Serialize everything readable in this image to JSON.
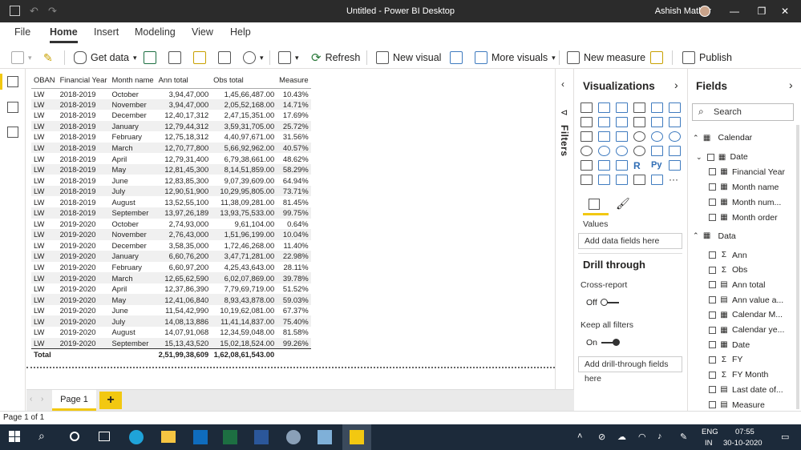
{
  "window": {
    "title": "Untitled - Power BI Desktop",
    "user": "Ashish Mathur"
  },
  "menu": [
    "File",
    "Home",
    "Insert",
    "Modeling",
    "View",
    "Help"
  ],
  "menu_active": "Home",
  "ribbon": {
    "get_data": "Get data",
    "refresh": "Refresh",
    "new_visual": "New visual",
    "more_visuals": "More visuals",
    "new_measure": "New measure",
    "publish": "Publish"
  },
  "table": {
    "headers": [
      "OBAN",
      "Financial Year",
      "Month name",
      "Ann total",
      "Obs total",
      "Measure"
    ],
    "rows": [
      [
        "LW",
        "2018-2019",
        "October",
        "3,94,47,000",
        "1,45,66,487.00",
        "10.43%"
      ],
      [
        "LW",
        "2018-2019",
        "November",
        "3,94,47,000",
        "2,05,52,168.00",
        "14.71%"
      ],
      [
        "LW",
        "2018-2019",
        "December",
        "12,40,17,312",
        "2,47,15,351.00",
        "17.69%"
      ],
      [
        "LW",
        "2018-2019",
        "January",
        "12,79,44,312",
        "3,59,31,705.00",
        "25.72%"
      ],
      [
        "LW",
        "2018-2019",
        "February",
        "12,75,18,312",
        "4,40,97,671.00",
        "31.56%"
      ],
      [
        "LW",
        "2018-2019",
        "March",
        "12,70,77,800",
        "5,66,92,962.00",
        "40.57%"
      ],
      [
        "LW",
        "2018-2019",
        "April",
        "12,79,31,400",
        "6,79,38,661.00",
        "48.62%"
      ],
      [
        "LW",
        "2018-2019",
        "May",
        "12,81,45,300",
        "8,14,51,859.00",
        "58.29%"
      ],
      [
        "LW",
        "2018-2019",
        "June",
        "12,83,85,300",
        "9,07,39,609.00",
        "64.94%"
      ],
      [
        "LW",
        "2018-2019",
        "July",
        "12,90,51,900",
        "10,29,95,805.00",
        "73.71%"
      ],
      [
        "LW",
        "2018-2019",
        "August",
        "13,52,55,100",
        "11,38,09,281.00",
        "81.45%"
      ],
      [
        "LW",
        "2018-2019",
        "September",
        "13,97,26,189",
        "13,93,75,533.00",
        "99.75%"
      ],
      [
        "LW",
        "2019-2020",
        "October",
        "2,74,93,000",
        "9,61,104.00",
        "0.64%"
      ],
      [
        "LW",
        "2019-2020",
        "November",
        "2,76,43,000",
        "1,51,96,199.00",
        "10.04%"
      ],
      [
        "LW",
        "2019-2020",
        "December",
        "3,58,35,000",
        "1,72,46,268.00",
        "11.40%"
      ],
      [
        "LW",
        "2019-2020",
        "January",
        "6,60,76,200",
        "3,47,71,281.00",
        "22.98%"
      ],
      [
        "LW",
        "2019-2020",
        "February",
        "6,60,97,200",
        "4,25,43,643.00",
        "28.11%"
      ],
      [
        "LW",
        "2019-2020",
        "March",
        "12,65,62,590",
        "6,02,07,869.00",
        "39.78%"
      ],
      [
        "LW",
        "2019-2020",
        "April",
        "12,37,86,390",
        "7,79,69,719.00",
        "51.52%"
      ],
      [
        "LW",
        "2019-2020",
        "May",
        "12,41,06,840",
        "8,93,43,878.00",
        "59.03%"
      ],
      [
        "LW",
        "2019-2020",
        "June",
        "11,54,42,990",
        "10,19,62,081.00",
        "67.37%"
      ],
      [
        "LW",
        "2019-2020",
        "July",
        "14,08,13,886",
        "11,41,14,837.00",
        "75.40%"
      ],
      [
        "LW",
        "2019-2020",
        "August",
        "14,07,91,068",
        "12,34,59,048.00",
        "81.58%"
      ],
      [
        "LW",
        "2019-2020",
        "September",
        "15,13,43,520",
        "15,02,18,524.00",
        "99.26%"
      ]
    ],
    "total": {
      "label": "Total",
      "ann": "2,51,99,38,609",
      "obs": "1,62,08,61,543.00"
    }
  },
  "page_tab": "Page 1",
  "add_page": "+",
  "filters_label": "Filters",
  "viz": {
    "title": "Visualizations",
    "values_label": "Values",
    "values_well": "Add data fields here",
    "drill_title": "Drill through",
    "cross_report": "Cross-report",
    "cross_state": "Off",
    "keep_filters": "Keep all filters",
    "keep_state": "On",
    "drill_well": "Add drill-through fields here",
    "more": "···"
  },
  "fields": {
    "title": "Fields",
    "search_placeholder": "Search",
    "tables": [
      {
        "name": "Calendar",
        "items": [
          {
            "name": "Date",
            "sym": "cal",
            "expand": true
          },
          {
            "name": "Financial Year",
            "sym": "col"
          },
          {
            "name": "Month name",
            "sym": "col"
          },
          {
            "name": "Month num...",
            "sym": "col"
          },
          {
            "name": "Month order",
            "sym": "col"
          }
        ]
      },
      {
        "name": "Data",
        "items": [
          {
            "name": "Ann",
            "sym": "sigma"
          },
          {
            "name": "Obs",
            "sym": "sigma"
          },
          {
            "name": "Ann total",
            "sym": "calc"
          },
          {
            "name": "Ann value a...",
            "sym": "calc"
          },
          {
            "name": "Calendar M...",
            "sym": "col"
          },
          {
            "name": "Calendar ye...",
            "sym": "col"
          },
          {
            "name": "Date",
            "sym": "cal"
          },
          {
            "name": "FY",
            "sym": "sigma"
          },
          {
            "name": "FY Month",
            "sym": "sigma"
          },
          {
            "name": "Last date of...",
            "sym": "calc"
          },
          {
            "name": "Measure",
            "sym": "calc"
          }
        ]
      }
    ]
  },
  "status": "Page 1 of 1",
  "taskbar": {
    "lang1": "ENG",
    "lang2": "IN",
    "time": "07:55",
    "date": "30-10-2020"
  },
  "colors": {
    "accent": "#f2c811",
    "titlebar": "#2b2b2b",
    "taskbar": "#1c2a3a"
  }
}
